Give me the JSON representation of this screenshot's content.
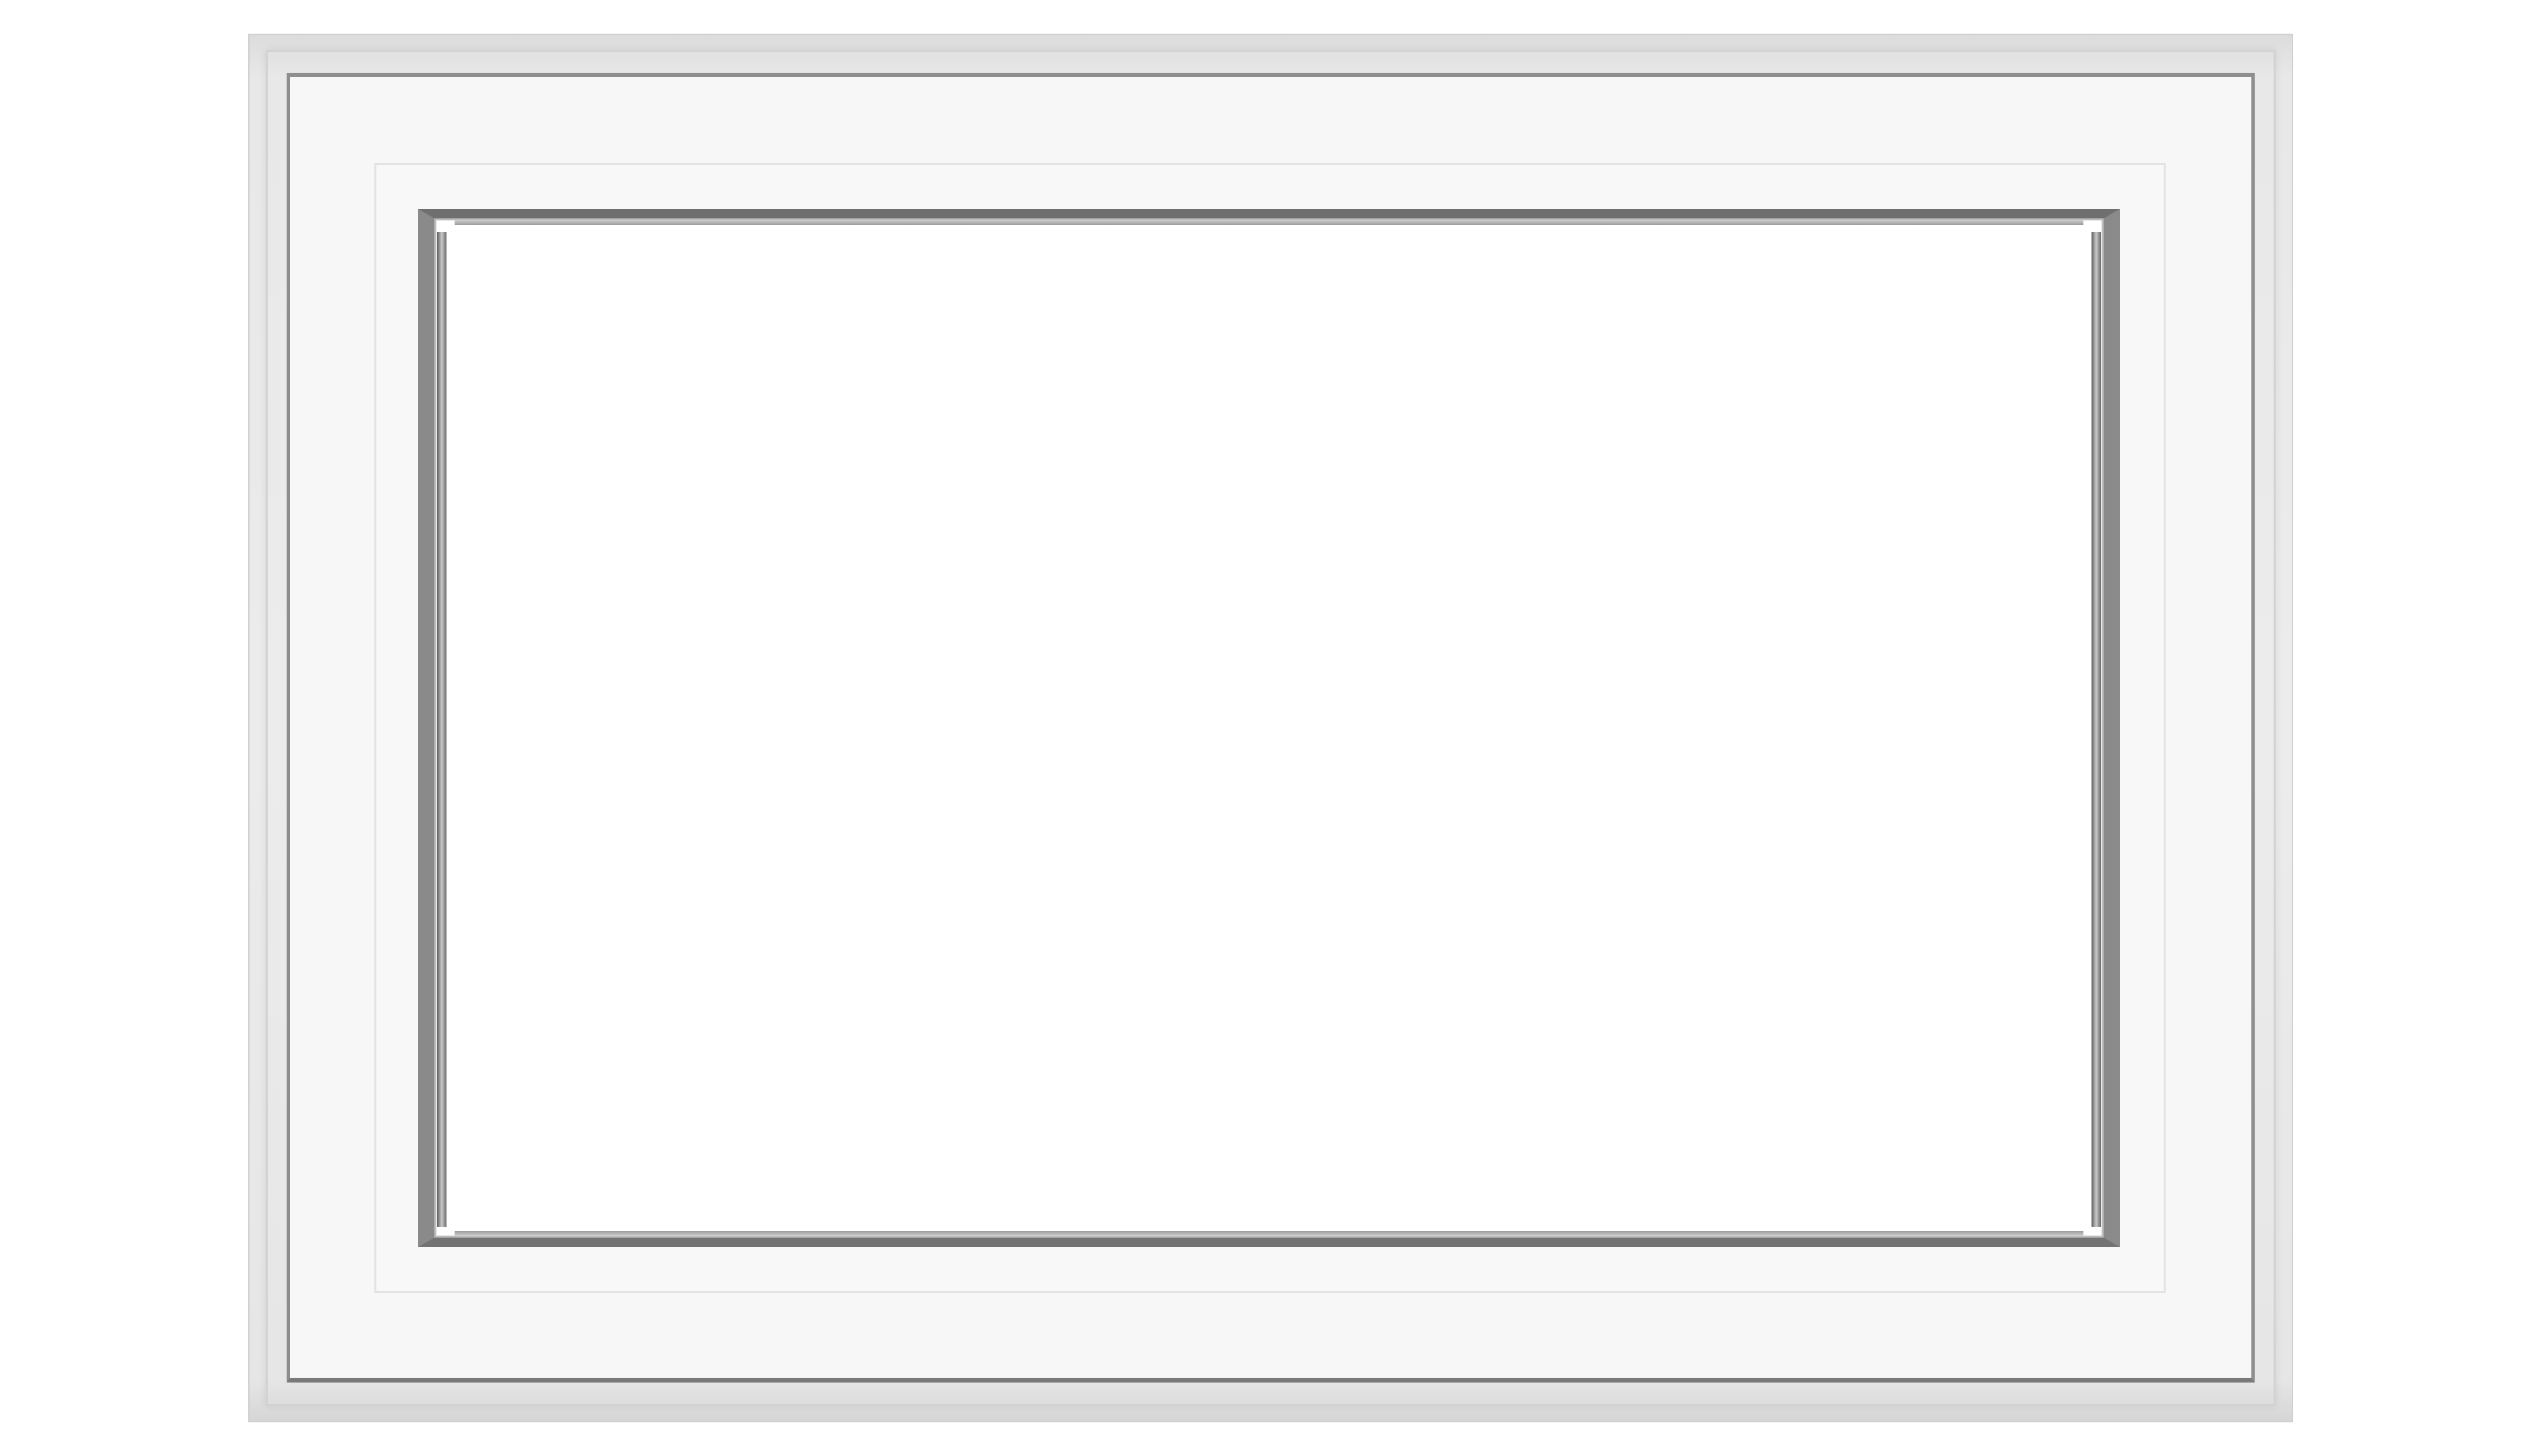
{
  "image": {
    "subject": "window",
    "frame_color": "#f7f7f7",
    "bead_color": "#8a8a8a",
    "glass_color": "#ffffff",
    "background_color": "#ffffff"
  }
}
